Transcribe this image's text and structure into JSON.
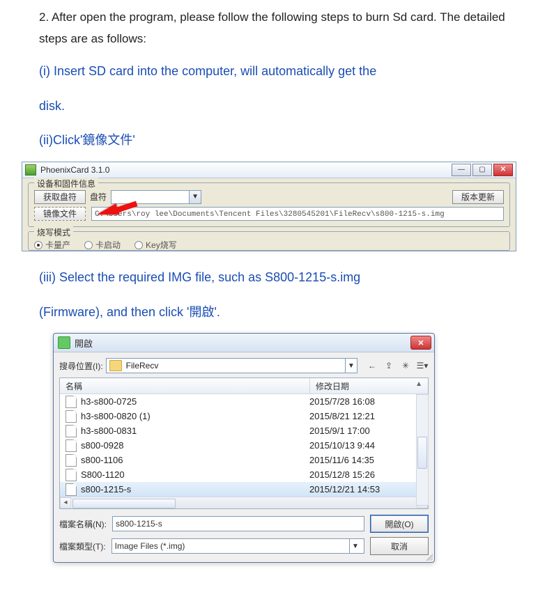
{
  "doc": {
    "intro": "2. After open the program, please follow the following steps to burn Sd card. The detailed steps are as follows:",
    "step1": "(i) Insert SD card into the computer, will automatically get the",
    "step1b": "disk.",
    "step2": "(ii)Click'鏡像文件'",
    "step3": "(iii) Select the required IMG file, such as S800-1215-s.img",
    "step3b": "(Firmware), and then click '開啟'."
  },
  "phoenix": {
    "title": "PhoenixCard 3.1.0",
    "fieldset_device": "设备和固件信息",
    "btn_get_disk": "获取盘符",
    "lbl_disk": "盘符",
    "btn_version": "版本更新",
    "btn_image": "镜像文件",
    "path": "C:\\Users\\roy lee\\Documents\\Tencent Files\\3280545201\\FileRecv\\s800-1215-s.img",
    "fieldset_mode": "烧写模式",
    "radio1": "卡量产",
    "radio2": "卡启动",
    "radio3": "Key烧写"
  },
  "dlg": {
    "title": "開啟",
    "look_in_label": "搜尋位置(I):",
    "folder_name": "FileRecv",
    "col_name": "名稱",
    "col_date": "修改日期",
    "files": [
      {
        "name": "h3-s800-0725",
        "date": "2015/7/28 16:08"
      },
      {
        "name": "h3-s800-0820 (1)",
        "date": "2015/8/21 12:21"
      },
      {
        "name": "h3-s800-0831",
        "date": "2015/9/1 17:00"
      },
      {
        "name": "s800-0928",
        "date": "2015/10/13 9:44"
      },
      {
        "name": "s800-1106",
        "date": "2015/11/6 14:35"
      },
      {
        "name": "S800-1120",
        "date": "2015/12/8 15:26"
      },
      {
        "name": "s800-1215-s",
        "date": "2015/12/21 14:53"
      }
    ],
    "selected_index": 6,
    "filename_label": "檔案名稱(N):",
    "filename_value": "s800-1215-s",
    "filetype_label": "檔案類型(T):",
    "filetype_value": "Image Files (*.img)",
    "btn_open": "開啟(O)",
    "btn_cancel": "取消"
  }
}
